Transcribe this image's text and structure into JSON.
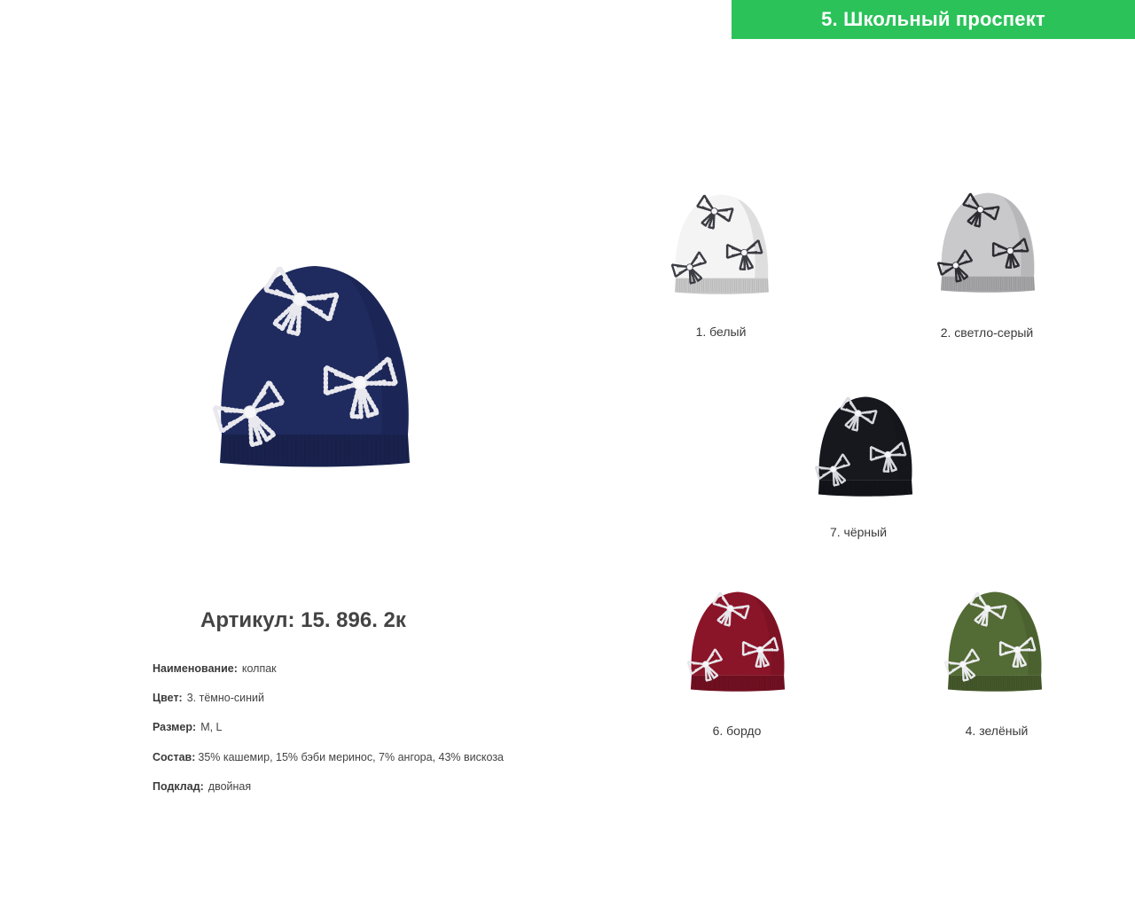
{
  "header": {
    "title": "5. Школьный проспект",
    "bg": "#2bc25a"
  },
  "main_product": {
    "color_name": "navy",
    "hex": "#1f2a5e",
    "bow_color": "#e8e8ee"
  },
  "variants": [
    {
      "id": "white",
      "label": "1. белый",
      "hex": "#f4f4f4",
      "bow": "#3c3c44"
    },
    {
      "id": "light-grey",
      "label": "2. светло-серый",
      "hex": "#c9c9cc",
      "bow": "#2c2c32"
    },
    {
      "id": "black",
      "label": "7. чёрный",
      "hex": "#16181e",
      "bow": "#d8d8de"
    },
    {
      "id": "bordeaux",
      "label": "6. бордо",
      "hex": "#8a1428",
      "bow": "#e6e6ea"
    },
    {
      "id": "green",
      "label": "4. зелёный",
      "hex": "#536b34",
      "bow": "#ececf0"
    }
  ],
  "article": {
    "title": "Артикул: 15. 896. 2к"
  },
  "specs": {
    "name": {
      "key": "Наименование:",
      "value": "колпак"
    },
    "color": {
      "key": "Цвет:",
      "value": "3. тёмно-синий"
    },
    "size": {
      "key": "Размер:",
      "value": "M, L"
    },
    "composition": {
      "key": "Состав:",
      "value": "35% кашемир, 15% бэби меринос, 7% ангора, 43% вискоза"
    },
    "lining": {
      "key": "Подклад:",
      "value": "двойная"
    }
  }
}
